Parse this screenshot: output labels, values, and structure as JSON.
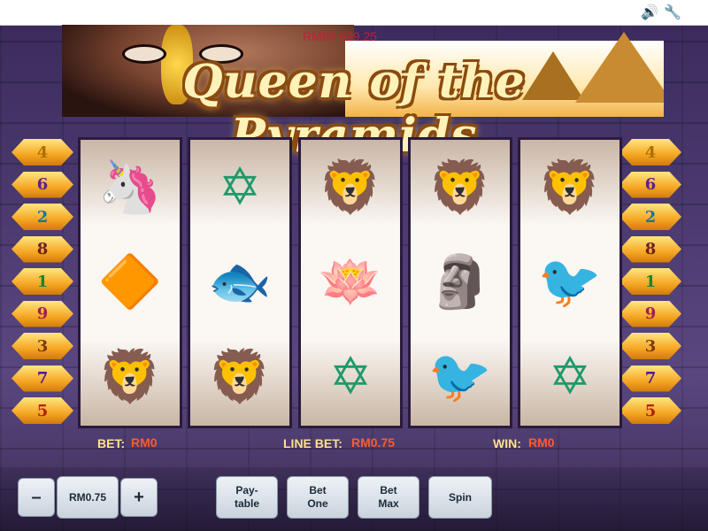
{
  "title": "Queen of the Pyramids",
  "jackpot": "RM80 639.25",
  "topbar": {
    "sound_icon": "speaker-icon",
    "settings_icon": "wrench-icon"
  },
  "paylines_left": [
    "4",
    "6",
    "2",
    "8",
    "1",
    "9",
    "3",
    "7",
    "5"
  ],
  "paylines_right": [
    "4",
    "6",
    "2",
    "8",
    "1",
    "9",
    "3",
    "7",
    "5"
  ],
  "payline_colors": {
    "4": "#b07000",
    "6": "#5a2090",
    "2": "#2070a0",
    "8": "#702020",
    "1": "#208030",
    "9": "#a02050",
    "3": "#7a3a10",
    "7": "#4a1a8a",
    "5": "#b02010"
  },
  "reels": [
    [
      "unicorn-head",
      "pyramid-ring",
      "sphinx"
    ],
    [
      "star-medallion",
      "three-fish",
      "sphinx"
    ],
    [
      "sphinx",
      "lotus-flower",
      "star-medallion"
    ],
    [
      "sphinx",
      "pharaoh-mask",
      "green-bird"
    ],
    [
      "sphinx",
      "green-bird",
      "star-medallion"
    ]
  ],
  "info": {
    "bet_label": "BET:",
    "bet_value": "RM0",
    "line_bet_label": "LINE BET:",
    "line_bet_value": "RM0.75",
    "win_label": "WIN:",
    "win_value": "RM0"
  },
  "controls": {
    "decrease": "–",
    "line_bet_display": "RM0.75",
    "increase": "+",
    "paytable": "Pay-\ntable",
    "bet_one": "Bet\nOne",
    "bet_max": "Bet\nMax",
    "spin": "Spin"
  }
}
